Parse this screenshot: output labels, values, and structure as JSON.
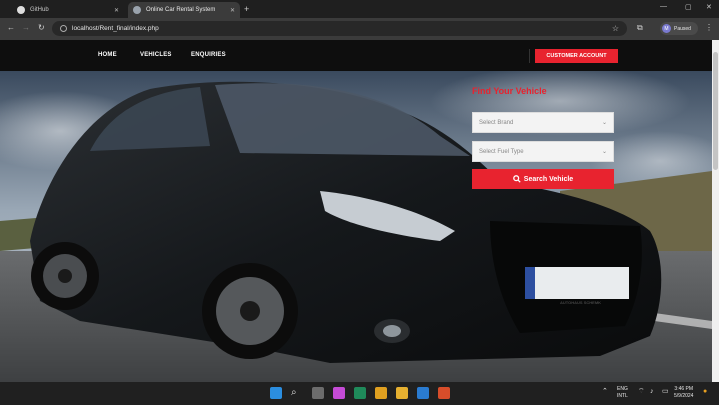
{
  "browser": {
    "tabs": [
      {
        "label": "GitHub"
      },
      {
        "label": "Online Car Rental System"
      }
    ],
    "new_tab": "+",
    "address": "localhost/Rent_final/index.php",
    "profile_initial": "M",
    "profile_label": "Paused"
  },
  "site": {
    "nav": [
      "HOME",
      "VEHICLES",
      "ENQUIRIES"
    ],
    "account_button": "CUSTOMER ACCOUNT",
    "accent": "#e8232f"
  },
  "search": {
    "title": "Find Your Vehicle",
    "brand_placeholder": "Select Brand",
    "fuel_placeholder": "Select Fuel Type",
    "button": "Search Vehicle"
  },
  "car": {
    "plate": "AUTOHAUS SCHEMK"
  },
  "taskbar": {
    "lang_top": "ENG",
    "lang_bottom": "INTL",
    "time": "3:46 PM",
    "date": "5/9/2024"
  }
}
